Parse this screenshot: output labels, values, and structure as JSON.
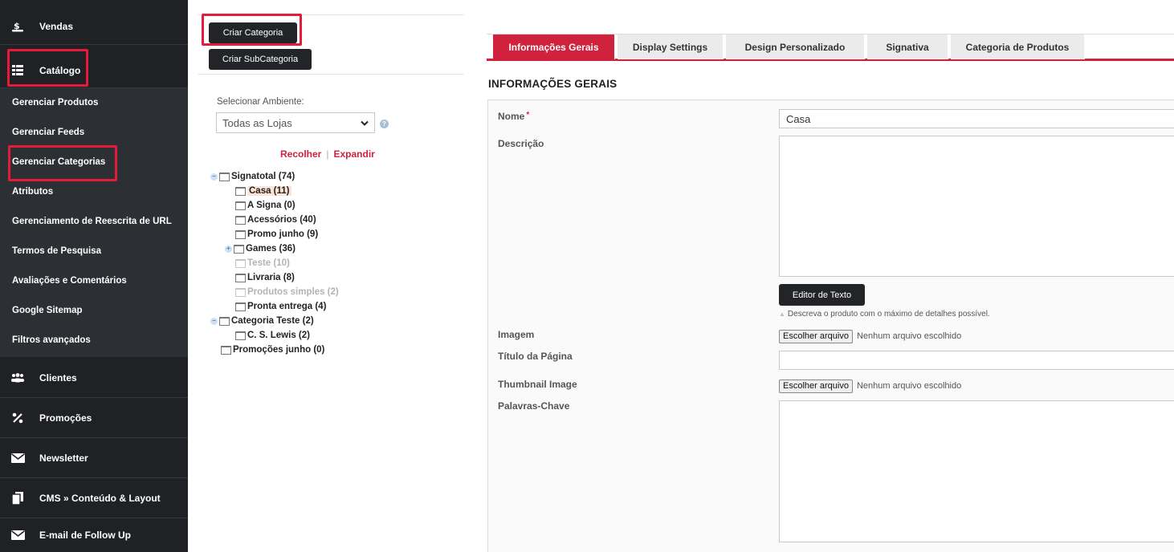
{
  "sidebar": {
    "top_items": [
      {
        "label": "Vendas",
        "icon": "money-icon"
      },
      {
        "label": "Catálogo",
        "icon": "grid-icon"
      }
    ],
    "catalog_items": [
      {
        "label": "Gerenciar Produtos"
      },
      {
        "label": "Gerenciar Feeds"
      },
      {
        "label": "Gerenciar Categorias"
      },
      {
        "label": "Atributos"
      },
      {
        "label": "Gerenciamento de Reescrita de URL"
      },
      {
        "label": "Termos de Pesquisa"
      },
      {
        "label": "Avaliações e Comentários"
      },
      {
        "label": "Google Sitemap"
      },
      {
        "label": "Filtros avançados"
      }
    ],
    "bottom_items": [
      {
        "label": "Clientes",
        "icon": "users-icon"
      },
      {
        "label": "Promoções",
        "icon": "percent-icon"
      },
      {
        "label": "Newsletter",
        "icon": "envelope-icon"
      },
      {
        "label": "CMS » Conteúdo & Layout",
        "icon": "page-icon"
      },
      {
        "label": "E-mail de Follow Up",
        "icon": "envelope-icon"
      }
    ]
  },
  "middle": {
    "create_category": "Criar Categoria",
    "create_subcategory": "Criar SubCategoria",
    "store_label": "Selecionar Ambiente:",
    "store_value": "Todas as Lojas",
    "collapse": "Recolher",
    "separator": "|",
    "expand": "Expandir",
    "tree": [
      {
        "label": "Signatotal (74)",
        "expander": "−"
      },
      {
        "label": "Casa (11)"
      },
      {
        "label": "A Signa (0)"
      },
      {
        "label": "Acessórios (40)"
      },
      {
        "label": "Promo junho (9)"
      },
      {
        "label": "Games (36)",
        "expander": "+"
      },
      {
        "label": "Teste (10)"
      },
      {
        "label": "Livraria (8)"
      },
      {
        "label": "Produtos simples (2)"
      },
      {
        "label": "Pronta entrega (4)"
      },
      {
        "label": "Categoria Teste (2)",
        "expander": "−"
      },
      {
        "label": "C. S. Lewis (2)"
      },
      {
        "label": "Promoções junho (0)"
      }
    ]
  },
  "tabs": [
    {
      "label": "Informações Gerais"
    },
    {
      "label": "Display Settings"
    },
    {
      "label": "Design Personalizado"
    },
    {
      "label": "Signativa"
    },
    {
      "label": "Categoria de Produtos"
    }
  ],
  "form": {
    "section_title": "INFORMAÇÕES GERAIS",
    "name_label": "Nome",
    "required_mark": "*",
    "name_value": "Casa",
    "description_label": "Descrição",
    "editor_button": "Editor de Texto",
    "hint_marker": "▲",
    "hint": "Descreva o produto com o máximo de detalhes possível.",
    "image_label": "Imagem",
    "file_button": "Escolher arquivo",
    "no_file": "Nenhum arquivo escolhido",
    "page_title_label": "Título da Página",
    "thumbnail_label": "Thumbnail Image",
    "keywords_label": "Palavras-Chave"
  },
  "colors": {
    "accent": "#d0213d",
    "highlight": "#e41b3b",
    "sidebar_bg": "#1f2124",
    "sidebar_sub_bg": "#2c2f33"
  }
}
